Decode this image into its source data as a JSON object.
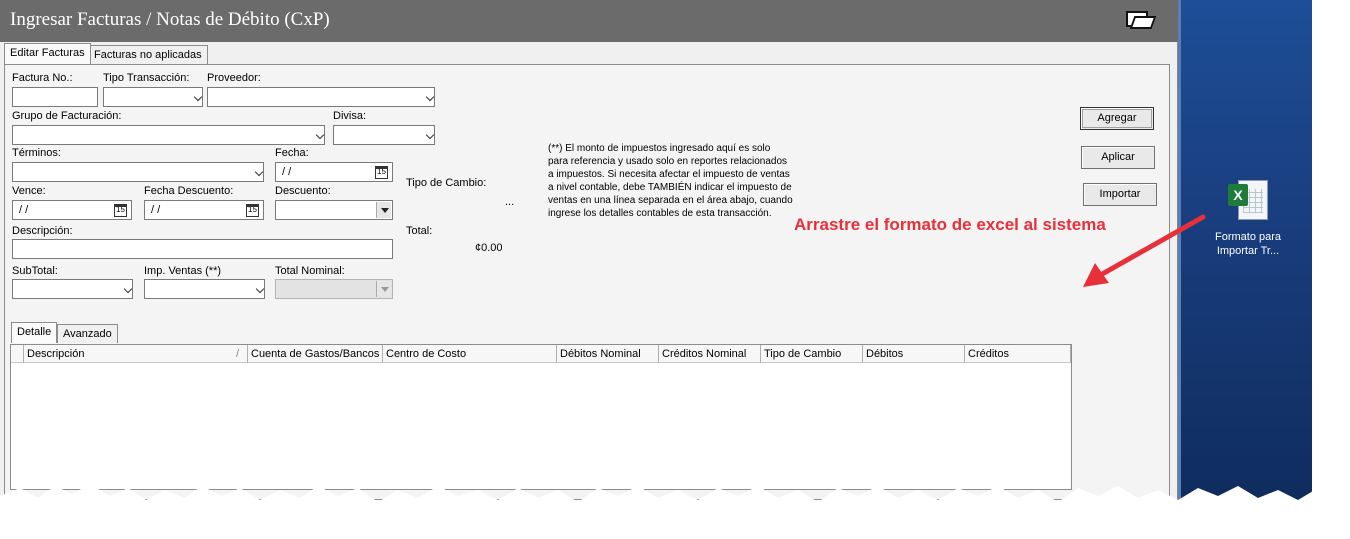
{
  "window": {
    "title": "Ingresar Facturas / Notas de Débito (CxP)",
    "folder_icon": "open-folder-icon"
  },
  "tabs": [
    {
      "label": "Editar Facturas"
    },
    {
      "label": "Facturas no aplicadas"
    }
  ],
  "form": {
    "factura_no": {
      "label": "Factura No.:",
      "value": ""
    },
    "tipo_transaccion": {
      "label": "Tipo Transacción:",
      "value": ""
    },
    "proveedor": {
      "label": "Proveedor:",
      "value": ""
    },
    "grupo_facturacion": {
      "label": "Grupo de Facturación:",
      "value": ""
    },
    "divisa": {
      "label": "Divisa:",
      "value": ""
    },
    "terminos": {
      "label": "Términos:",
      "value": ""
    },
    "fecha": {
      "label": "Fecha:",
      "value": "/ /"
    },
    "tipo_cambio": {
      "label": "Tipo de Cambio:",
      "value": "..."
    },
    "vence": {
      "label": "Vence:",
      "value": "/ /"
    },
    "fecha_descuento": {
      "label": "Fecha Descuento:",
      "value": "/ /"
    },
    "descuento": {
      "label": "Descuento:",
      "value": ""
    },
    "descripcion": {
      "label": "Descripción:",
      "value": ""
    },
    "total": {
      "label": "Total:",
      "value": "¢0.00"
    },
    "subtotal": {
      "label": "SubTotal:",
      "value": ""
    },
    "imp_ventas": {
      "label": "Imp. Ventas (**)",
      "value": ""
    },
    "total_nominal": {
      "label": "Total Nominal:",
      "value": ""
    },
    "calendar_glyph": "15"
  },
  "note": "(**) El monto de impuestos ingresado aquí es solo para referencia y usado solo en reportes relacionados a impuestos. Si necesita afectar el impuesto de ventas a nivel contable, debe TAMBIÉN indicar el impuesto de ventas en una línea separada en el área abajo, cuando ingrese los detalles contables de esta transacción.",
  "buttons": {
    "agregar": "Agregar",
    "aplicar": "Aplicar",
    "importar": "Importar"
  },
  "subtabs": [
    {
      "label": "Detalle"
    },
    {
      "label": "Avanzado"
    }
  ],
  "grid": {
    "sort_indicator": "/",
    "columns": [
      "Descripción",
      "Cuenta de Gastos/Bancos",
      "Centro de Costo",
      "Débitos Nominal",
      "Créditos Nominal",
      "Tipo de Cambio",
      "Débitos",
      "Créditos"
    ]
  },
  "annotation": {
    "text": "Arrastre el formato de excel al sistema",
    "color": "#e8303a"
  },
  "desktop": {
    "icon": "excel-file-icon",
    "icon_label_line1": "Formato para",
    "icon_label_line2": "Importar Tr..."
  },
  "colors": {
    "titlebar": "#6b6b6b",
    "desktop": "#1a3f80",
    "annotation": "#e8303a"
  }
}
